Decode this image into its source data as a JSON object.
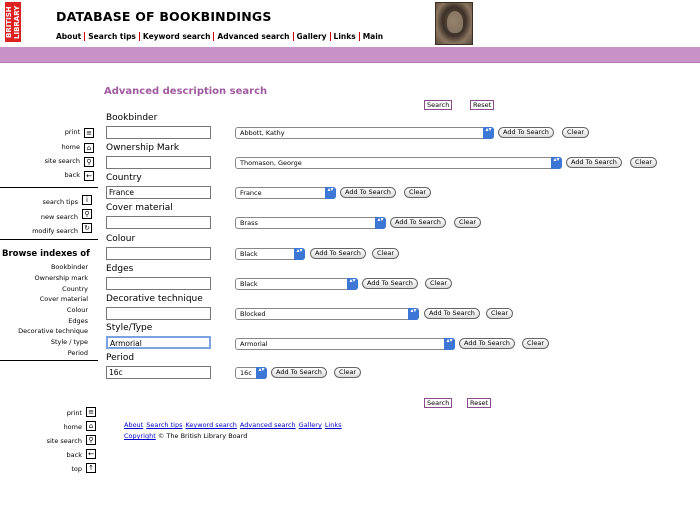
{
  "header": {
    "logo_text": "BRITISH LIBRARY",
    "title": "DATABASE OF BOOKBINDINGS",
    "nav": [
      "About",
      "Search tips",
      "Keyword search",
      "Advanced search",
      "Gallery",
      "Links",
      "Main"
    ]
  },
  "sidebar": {
    "top_links": [
      "print",
      "home",
      "site search",
      "back"
    ],
    "search_links": [
      "search tips",
      "new search",
      "modify search"
    ],
    "browse_title": "Browse indexes of",
    "browse_items": [
      "Bookbinder",
      "Ownership mark",
      "Country",
      "Cover material",
      "Colour",
      "Edges",
      "Decorative technique",
      "Style / type",
      "Period"
    ],
    "bottom_links": [
      "print",
      "home",
      "site search",
      "back",
      "top"
    ]
  },
  "form": {
    "title": "Advanced description search",
    "search_label": "Search",
    "reset_label": "Reset",
    "add_label": "Add To Search",
    "clear_label": "Clear",
    "fields": [
      {
        "label": "Bookbinder",
        "text": "",
        "select": "Abbott, Kathy"
      },
      {
        "label": "Ownership Mark",
        "text": "",
        "select": "Thomason, George"
      },
      {
        "label": "Country",
        "text": "France",
        "select": "France"
      },
      {
        "label": "Cover material",
        "text": "",
        "select": "Brass"
      },
      {
        "label": "Colour",
        "text": "",
        "select": "Black"
      },
      {
        "label": "Edges",
        "text": "",
        "select": "Black"
      },
      {
        "label": "Decorative technique",
        "text": "",
        "select": "Blocked"
      },
      {
        "label": "Style/Type",
        "text": "Armorial",
        "select": "Armorial"
      },
      {
        "label": "Period",
        "text": "16c",
        "select": "16c"
      }
    ]
  },
  "footer": {
    "links": [
      "About",
      "Search tips",
      "Keyword search",
      "Advanced search",
      "Gallery",
      "Links"
    ],
    "copyright_word": "Copyright",
    "copyright_rest": "© The British Library Board"
  }
}
